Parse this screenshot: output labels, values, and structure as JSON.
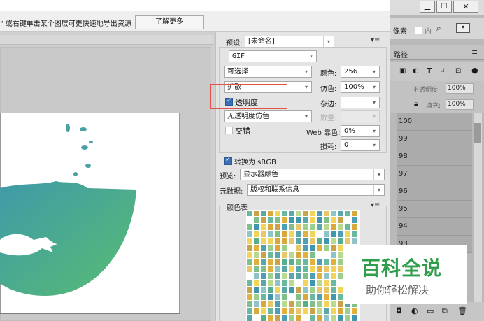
{
  "top": {
    "hint": "\" 或右键单击某个图层可更快速地导出资源",
    "learn_more": "了解更多"
  },
  "settings": {
    "preset_label": "预设:",
    "preset_value": "[未命名]",
    "format": "GIF",
    "reduction": "可选择",
    "colors_label": "颜色:",
    "colors_value": "256",
    "dither_algo": "扩散",
    "dither_label": "仿色:",
    "dither_value": "100%",
    "transparency_label": "透明度",
    "matte_label": "杂边:",
    "trans_dither": "无透明度仿色",
    "amount_label": "数量:",
    "interlaced_label": "交错",
    "web_snap_label": "Web 靠色:",
    "web_snap_value": "0%",
    "lossy_label": "损耗:",
    "lossy_value": "0",
    "convert_srgb_label": "转换为 sRGB",
    "preview_label": "预览:",
    "preview_value": "显示器颜色",
    "metadata_label": "元数据:",
    "metadata_value": "版权和联系信息",
    "color_table_label": "颜色表"
  },
  "ps": {
    "tab_label": "像素",
    "tab_label2": "内",
    "paths_tab": "路径",
    "opacity_label": "不透明度:",
    "opacity_value": "100%",
    "fill_label": "填充:",
    "fill_value": "100%",
    "layers": [
      "100",
      "99",
      "98",
      "97",
      "96",
      "95",
      "94",
      "93"
    ]
  },
  "watermark": {
    "title": "百科全说",
    "subtitle": "助你轻松解决"
  },
  "colors": {
    "teal": "#4aa6a0",
    "green": "#52b87a"
  }
}
